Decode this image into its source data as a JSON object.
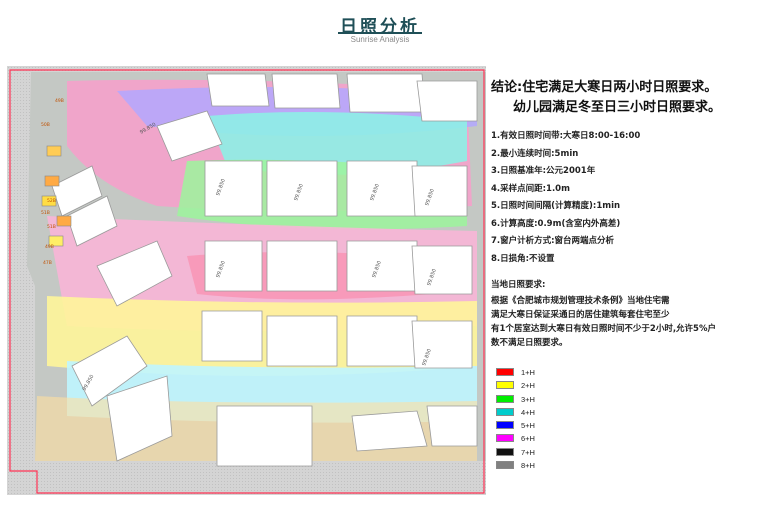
{
  "header": {
    "title": "日照分析",
    "subtitle": "Sunrise Analysis"
  },
  "panel": {
    "conclusion": [
      "结论:住宅满足大寒日两小时日照要求。",
      "幼儿园满足冬至日三小时日照要求。"
    ],
    "params": [
      "1.有效日照时间带:大寒日8:00-16:00",
      "2.最小连续时间:5min",
      "3.日照基准年:公元2001年",
      "4.采样点间距:1.0m",
      "5.日照时间间隔(计算精度):1min",
      "6.计算高度:0.9m(含室内外高差)",
      "7.窗户计析方式:窗台两端点分析",
      "8.日损角:不设置"
    ],
    "requirement_title": "当地日照要求:",
    "requirement_lines": [
      "根据《合肥城市规划管理技术条例》当地住宅需",
      "满足大寒日保证采通日的居住建筑每套住宅至少",
      "有1个居室达到大寒日有效日照时间不少于2小时,允许5%户",
      "数不满足日照要求。"
    ]
  },
  "legend": [
    {
      "label": "1+H",
      "color": "#ff0000"
    },
    {
      "label": "2+H",
      "color": "#ffff00"
    },
    {
      "label": "3+H",
      "color": "#00ee00"
    },
    {
      "label": "4+H",
      "color": "#00cccc"
    },
    {
      "label": "5+H",
      "color": "#0000ff"
    },
    {
      "label": "6+H",
      "color": "#ff00ff"
    },
    {
      "label": "7+H",
      "color": "#111111"
    },
    {
      "label": "8+H",
      "color": "#808080"
    }
  ],
  "map": {
    "building_labels": [
      "99.850",
      "99.850",
      "99.850",
      "99.850",
      "99.850",
      "99.850",
      "99.850",
      "99.850",
      "99.850",
      "99.850"
    ],
    "small_labels": [
      "49B",
      "50B",
      "52B",
      "51B",
      "51B",
      "49B",
      "47B"
    ]
  }
}
